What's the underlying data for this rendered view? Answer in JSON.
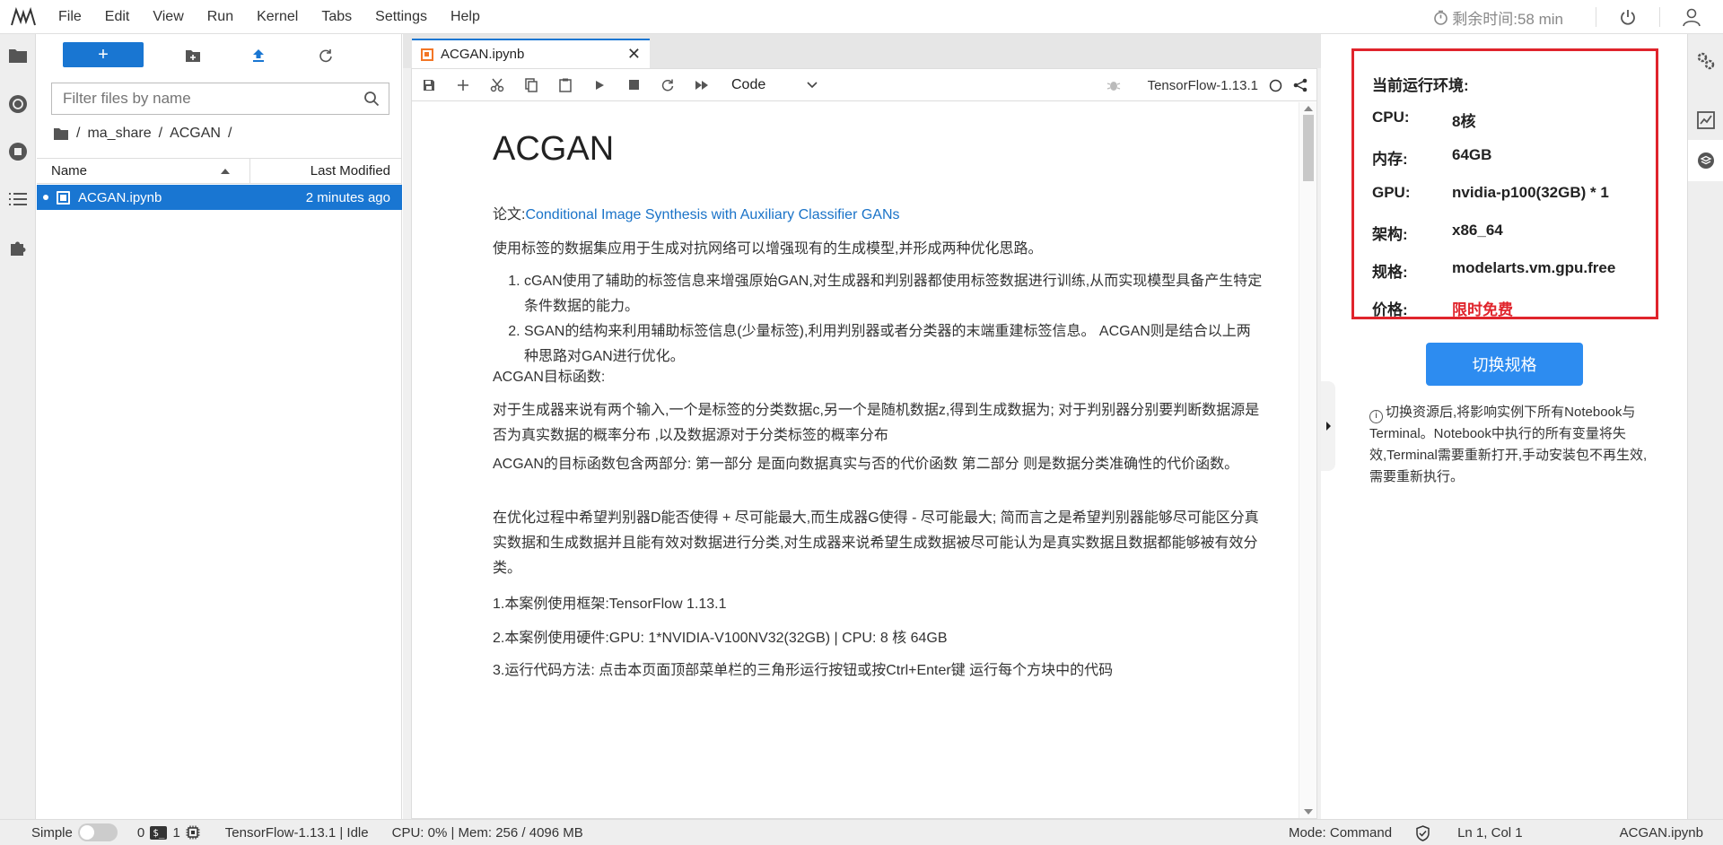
{
  "menu": {
    "items": [
      "File",
      "Edit",
      "View",
      "Run",
      "Kernel",
      "Tabs",
      "Settings",
      "Help"
    ],
    "timer": "剩余时间:58 min"
  },
  "filebrowser": {
    "filter_placeholder": "Filter files by name",
    "breadcrumb": [
      "ma_share",
      "ACGAN"
    ],
    "columns": {
      "name": "Name",
      "modified": "Last Modified"
    },
    "files": [
      {
        "name": "ACGAN.ipynb",
        "modified": "2 minutes ago"
      }
    ]
  },
  "notebook": {
    "tab_title": "ACGAN.ipynb",
    "cell_type": "Code",
    "kernel": "TensorFlow-1.13.1",
    "heading": "ACGAN",
    "paper_label": "论文:",
    "paper_link": "Conditional Image Synthesis with Auxiliary Classifier GANs",
    "intro": "使用标签的数据集应用于生成对抗网络可以增强现有的生成模型,并形成两种优化思路。",
    "list": [
      "cGAN使用了辅助的标签信息来增强原始GAN,对生成器和判别器都使用标签数据进行训练,从而实现模型具备产生特定条件数据的能力。",
      "SGAN的结构来利用辅助标签信息(少量标签),利用判别器或者分类器的末端重建标签信息。 ACGAN则是结合以上两种思路对GAN进行优化。"
    ],
    "objective_title": "ACGAN目标函数:",
    "para1": "对于生成器来说有两个输入,一个是标签的分类数据c,另一个是随机数据z,得到生成数据为; 对于判别器分别要判断数据源是否为真实数据的概率分布 ,以及数据源对于分类标签的概率分布",
    "para2": "ACGAN的目标函数包含两部分: 第一部分 是面向数据真实与否的代价函数 第二部分 则是数据分类准确性的代价函数。",
    "para3": "在优化过程中希望判别器D能否使得 + 尽可能最大,而生成器G使得 - 尽可能最大; 简而言之是希望判别器能够尽可能区分真实数据和生成数据并且能有效对数据进行分类,对生成器来说希望生成数据被尽可能认为是真实数据且数据都能够被有效分类。",
    "step1": "1.本案例使用框架:TensorFlow 1.13.1",
    "step2": "2.本案例使用硬件:GPU: 1*NVIDIA-V100NV32(32GB) | CPU: 8 核 64GB",
    "step3": "3.运行代码方法: 点击本页面顶部菜单栏的三角形运行按钮或按Ctrl+Enter键 运行每个方块中的代码"
  },
  "resources": {
    "title": "当前运行环境:",
    "rows": [
      {
        "key": "CPU:",
        "value": "8核"
      },
      {
        "key": "内存:",
        "value": "64GB"
      },
      {
        "key": "GPU:",
        "value": "nvidia-p100(32GB) * 1"
      },
      {
        "key": "架构:",
        "value": "x86_64"
      },
      {
        "key": "规格:",
        "value": "modelarts.vm.gpu.free"
      },
      {
        "key": "价格:",
        "value": "限时免费"
      }
    ],
    "switch_label": "切换规格",
    "notice": "切换资源后,将影响实例下所有Notebook与Terminal。Notebook中执行的所有变量将失效,Terminal需要重新打开,手动安装包不再生效,需要重新执行。"
  },
  "status": {
    "mode_label": "Simple",
    "kernels_count": "0",
    "terminals_count": "1",
    "kernel_status": "TensorFlow-1.13.1 | Idle",
    "mem": "CPU: 0% | Mem: 256 / 4096 MB",
    "mode": "Mode: Command",
    "cursor": "Ln 1, Col 1",
    "file": "ACGAN.ipynb"
  },
  "colors": {
    "accent": "#1976d2",
    "highlight_red": "#e0242c",
    "button_blue": "#2d8cf0"
  }
}
